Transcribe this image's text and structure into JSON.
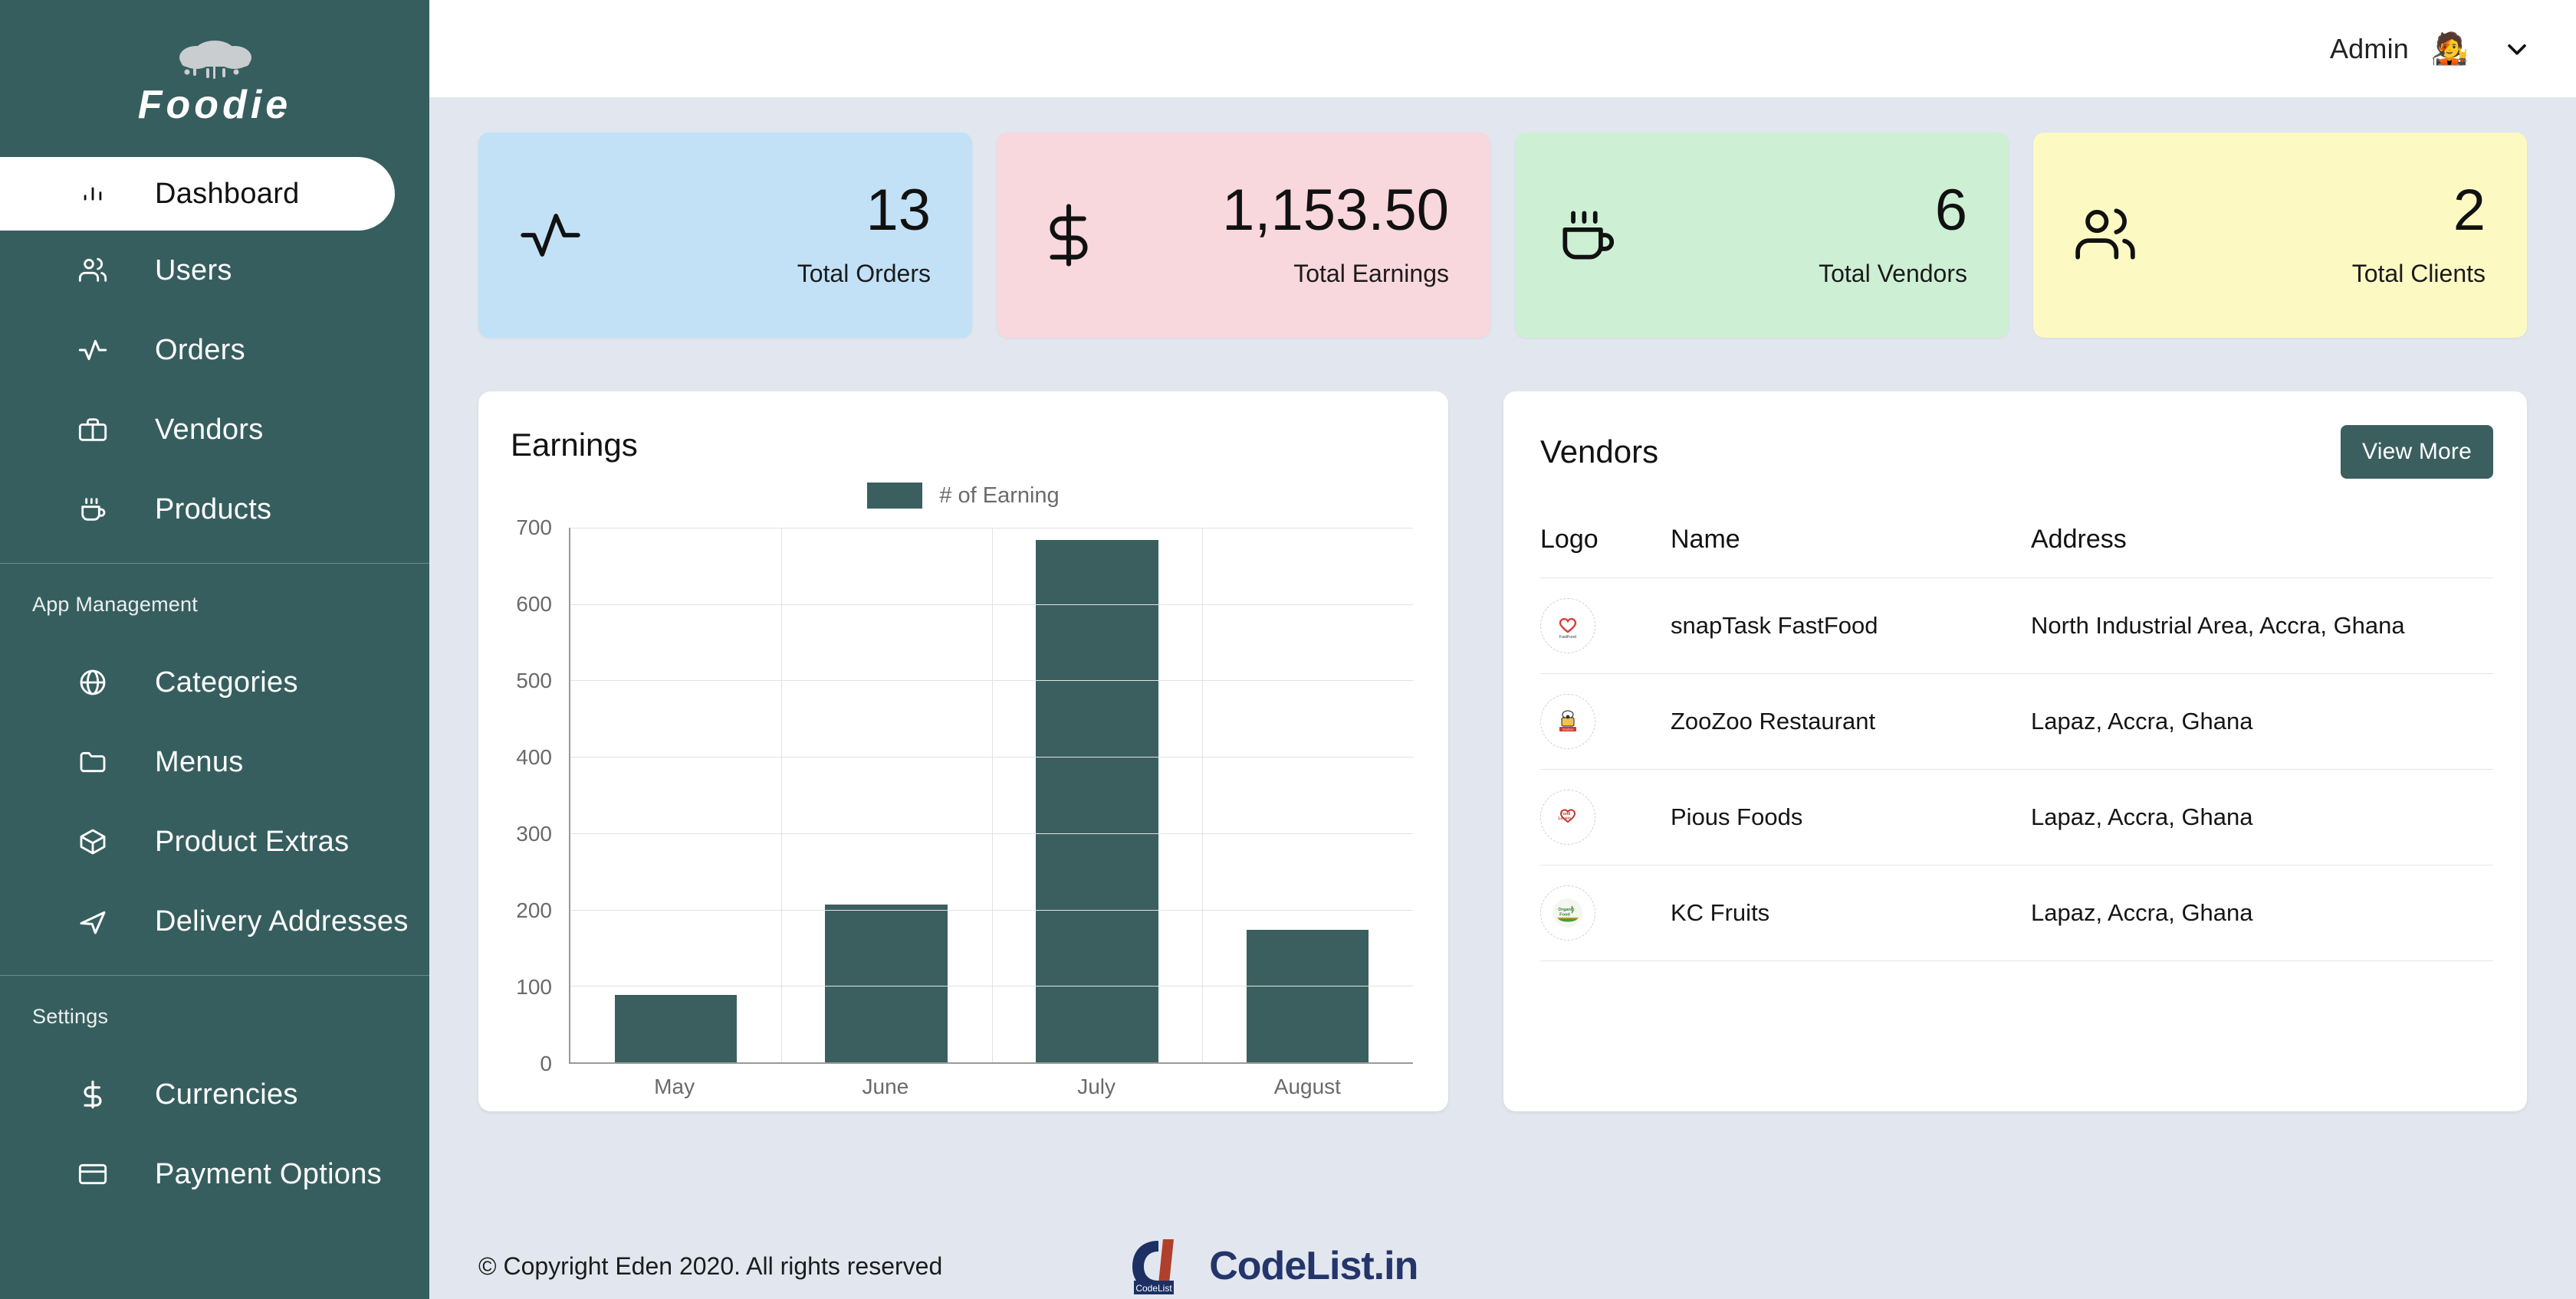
{
  "brand": {
    "name": "Foodie",
    "logo_icon": "cloud-icon"
  },
  "topbar": {
    "user_name": "Admin",
    "avatar_icon": "user-avatar",
    "caret_icon": "chevron-down-icon"
  },
  "sidebar": {
    "main_items": [
      {
        "label": "Dashboard",
        "icon": "bar-chart-icon",
        "active": true
      },
      {
        "label": "Users",
        "icon": "users-icon",
        "active": false
      },
      {
        "label": "Orders",
        "icon": "activity-icon",
        "active": false
      },
      {
        "label": "Vendors",
        "icon": "briefcase-icon",
        "active": false
      },
      {
        "label": "Products",
        "icon": "coffee-icon",
        "active": false
      }
    ],
    "app_management": {
      "title": "App Management",
      "items": [
        {
          "label": "Categories",
          "icon": "globe-icon"
        },
        {
          "label": "Menus",
          "icon": "folder-icon"
        },
        {
          "label": "Product Extras",
          "icon": "box-icon"
        },
        {
          "label": "Delivery Addresses",
          "icon": "send-icon"
        }
      ]
    },
    "settings": {
      "title": "Settings",
      "items": [
        {
          "label": "Currencies",
          "icon": "dollar-icon"
        },
        {
          "label": "Payment Options",
          "icon": "credit-card-icon"
        }
      ]
    }
  },
  "stats": [
    {
      "value": "13",
      "label": "Total Orders",
      "icon": "activity-icon",
      "color": "#c2e1f7"
    },
    {
      "value": "1,153.50",
      "label": "Total Earnings",
      "icon": "dollar-icon",
      "color": "#f8d7dd"
    },
    {
      "value": "6",
      "label": "Total Vendors",
      "icon": "coffee-icon",
      "color": "#cdf0d5"
    },
    {
      "value": "2",
      "label": "Total Clients",
      "icon": "users-icon",
      "color": "#fcf9c3"
    }
  ],
  "earnings_panel": {
    "title": "Earnings"
  },
  "chart_data": {
    "type": "bar",
    "title": "Earnings",
    "categories": [
      "May",
      "June",
      "July",
      "August"
    ],
    "series": [
      {
        "name": "# of Earning",
        "values": [
          88,
          207,
          684,
          174
        ],
        "color": "#3b5f5f"
      }
    ],
    "legend": [
      "# of Earning"
    ],
    "legend_position": "top-center",
    "xlabel": "",
    "ylabel": "",
    "ylim": [
      0,
      700
    ],
    "yticks": [
      0,
      100,
      200,
      300,
      400,
      500,
      600,
      700
    ],
    "grid": true
  },
  "vendors_panel": {
    "title": "Vendors",
    "view_more_label": "View More",
    "columns": [
      "Logo",
      "Name",
      "Address"
    ],
    "rows": [
      {
        "logo": "snaptask-logo",
        "name": "snapTask FastFood",
        "address": "North Industrial Area, Accra, Ghana"
      },
      {
        "logo": "zoozoo-logo",
        "name": "ZooZoo Restaurant",
        "address": "Lapaz, Accra, Ghana"
      },
      {
        "logo": "pious-foods-logo",
        "name": "Pious Foods",
        "address": "Lapaz, Accra, Ghana"
      },
      {
        "logo": "kc-fruits-logo",
        "name": "KC Fruits",
        "address": "Lapaz, Accra, Ghana"
      }
    ]
  },
  "footer": {
    "copyright": "© Copyright Eden 2020. All rights reserved",
    "codelist_text": "CodeList.in",
    "codelist_badge": "CodeList"
  },
  "colors": {
    "sidebar": "#375e5e",
    "accent": "#3b5f5f",
    "page_bg": "#e2e7ef",
    "card_blue": "#c2e1f7",
    "card_pink": "#f8d7dd",
    "card_green": "#cdf0d5",
    "card_yellow": "#fcf9c3"
  }
}
